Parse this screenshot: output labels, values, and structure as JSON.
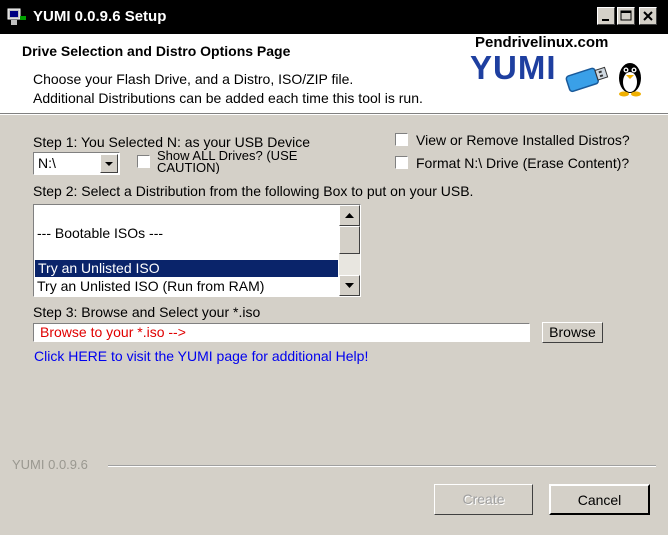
{
  "window": {
    "title": "YUMI 0.0.9.6 Setup",
    "icons": {
      "app": "usb-drive-icon",
      "minimize": "minimize-icon",
      "maximize": "maximize-icon",
      "close": "close-icon"
    }
  },
  "header": {
    "title": "Drive Selection and Distro Options Page",
    "description": "Choose your Flash Drive, and a Distro, ISO/ZIP file.\nAdditional Distributions can be added each time this tool is run.",
    "logo": {
      "site": "Pendrivelinux.com",
      "word": "YUMI",
      "icon": "usb-penguin-icon"
    }
  },
  "step1": {
    "label": "Step 1: You Selected N: as your USB Device",
    "drive_value": "N:\\",
    "show_all_drives_label": "Show ALL Drives? (USE CAUTION)",
    "show_all_drives_checked": false
  },
  "options": {
    "view_remove_label": "View or Remove Installed Distros?",
    "view_remove_checked": false,
    "format_label": "Format N:\\ Drive (Erase Content)?",
    "format_checked": false
  },
  "step2": {
    "label": "Step 2: Select a Distribution from the following Box to put on your USB.",
    "list_items": [
      {
        "text": "--- Bootable ISOs ---",
        "selected": false
      },
      {
        "text": "Try an Unlisted ISO",
        "selected": true
      },
      {
        "text": "Try an Unlisted ISO (Run from RAM)",
        "selected": false
      }
    ]
  },
  "step3": {
    "label": "Step 3: Browse and Select your *.iso",
    "iso_value": "Browse to your *.iso  -->",
    "browse_label": "Browse"
  },
  "help_link": "Click HERE to visit the YUMI page for additional Help!",
  "footer": {
    "version": "YUMI 0.0.9.6",
    "create_label": "Create",
    "create_enabled": false,
    "cancel_label": "Cancel"
  },
  "colors": {
    "titlebar": "#000000",
    "face": "#d4d0c8",
    "selection": "#0a246a",
    "link": "#0000ee",
    "iso_text": "#e00000",
    "logo_blue": "#1e3fa0"
  }
}
